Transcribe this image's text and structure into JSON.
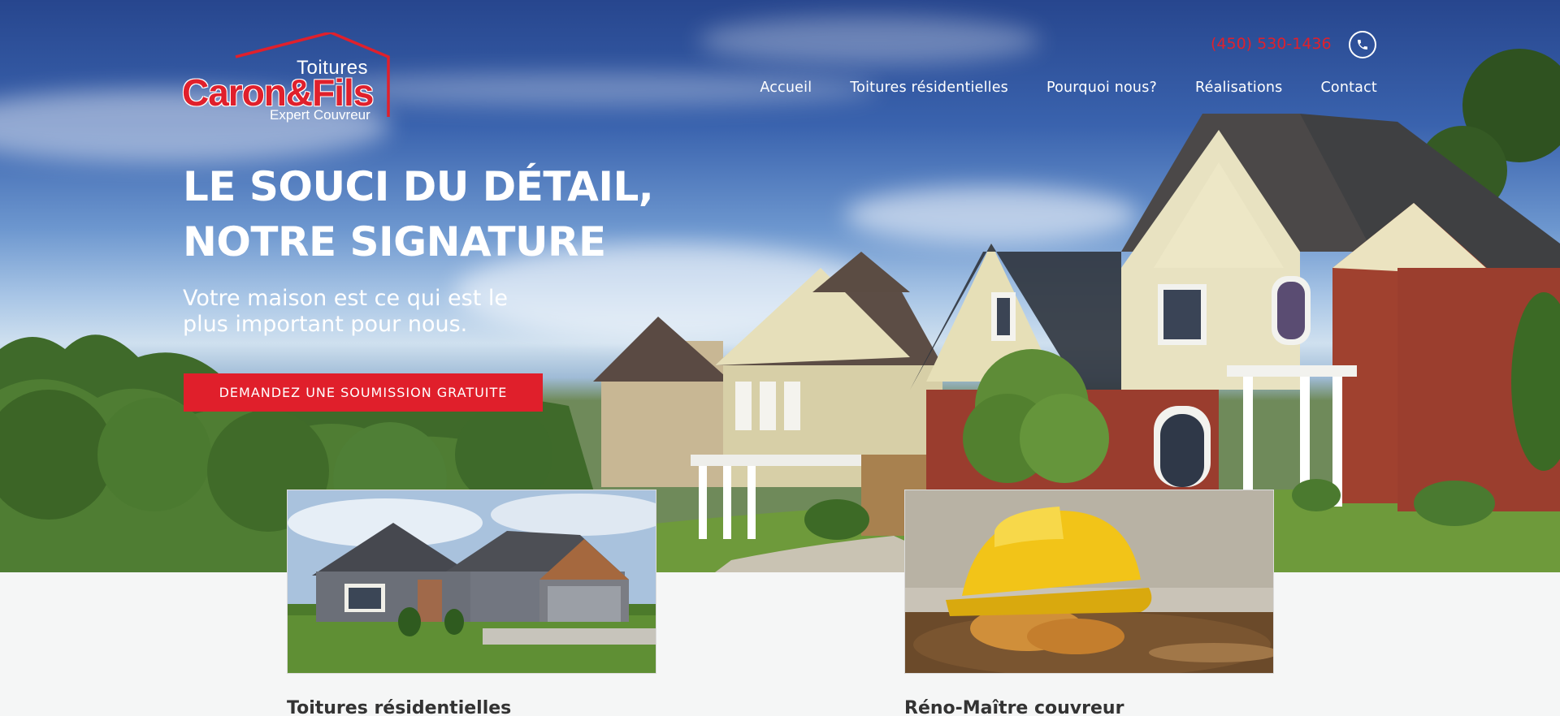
{
  "header": {
    "logo": {
      "top_text": "Toitures",
      "main_text": "Caron&Fils",
      "sub_text": "Expert Couvreur"
    },
    "phone": "(450) 530-1436",
    "phone_icon": "phone-icon",
    "nav": [
      {
        "label": "Accueil"
      },
      {
        "label": "Toitures résidentielles"
      },
      {
        "label": "Pourquoi nous?"
      },
      {
        "label": "Réalisations"
      },
      {
        "label": "Contact"
      }
    ]
  },
  "hero": {
    "title_line1": "LE SOUCI DU DÉTAIL,",
    "title_line2": "NOTRE SIGNATURE",
    "subtitle_line1": "Votre maison est ce qui est le",
    "subtitle_line2": "plus important pour nous.",
    "cta_label": "DEMANDEZ UNE SOUMISSION GRATUITE"
  },
  "cards": [
    {
      "title": "Toitures résidentielles"
    },
    {
      "title": "Réno-Maître couvreur"
    }
  ],
  "colors": {
    "accent": "#e01f2b",
    "text_light": "#ffffff",
    "text_dark": "#333333",
    "page_bg": "#f5f6f6"
  }
}
